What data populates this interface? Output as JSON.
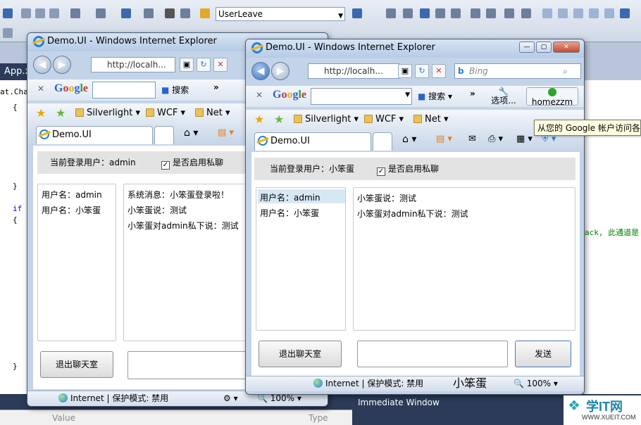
{
  "vs": {
    "config_combo": "UserLeave",
    "tab_label": "App.x",
    "left_snippet": "at.Chat",
    "code_brace_open": "{",
    "code_brace_close": "}",
    "code_if": "if",
    "right_snippet": "ack, 此通道是",
    "immediate_window": "Immediate Window",
    "value_col": "Value",
    "type_col": "Type"
  },
  "window1": {
    "title": "Demo.UI - Windows Internet Explorer",
    "address": "http://localh...",
    "google_search_label": "搜索",
    "favorites": [
      "Silverlight",
      "WCF",
      "Net"
    ],
    "tab_label": "Demo.UI",
    "current_user_label": "当前登录用户：admin",
    "private_chat_label": "是否启用私聊",
    "users": [
      "用户名：admin",
      "用户名：小笨蛋"
    ],
    "messages": [
      "系统消息：小笨蛋登录啦！",
      "小笨蛋说：测试",
      "小笨蛋对admin私下说：测试"
    ],
    "leave_button": "退出聊天室",
    "status_zone": "Internet | 保护模式: 禁用",
    "zoom": "100%"
  },
  "window2": {
    "title": "Demo.UI - Windows Internet Explorer",
    "address": "http://localh...",
    "bing_placeholder": "Bing",
    "google_search_label": "搜索",
    "options_label": "选项...",
    "account_label": "homezzm",
    "favorites": [
      "Silverlight",
      "WCF",
      "Net"
    ],
    "tab_label": "Demo.UI",
    "tooltip": "从您的 Google 帐户访问各",
    "current_user_label": "当前登录用户：小笨蛋",
    "private_chat_label": "是否启用私聊",
    "users": [
      "用户名：admin",
      "用户名：小笨蛋"
    ],
    "messages": [
      "小笨蛋说：测试",
      "小笨蛋对admin私下说：测试"
    ],
    "leave_button": "退出聊天室",
    "send_button": "发送",
    "status_zone": "Internet | 保护模式: 禁用",
    "ime_text": "小笨蛋",
    "zoom": "100%"
  },
  "watermark": {
    "brand": "学IT网",
    "url": "WWW.XUEIT.COM"
  },
  "colors": {
    "vs_dark": "#2b3b58",
    "selected_row": "#d7e8f5",
    "ie_frame": "#c4d4e8"
  }
}
